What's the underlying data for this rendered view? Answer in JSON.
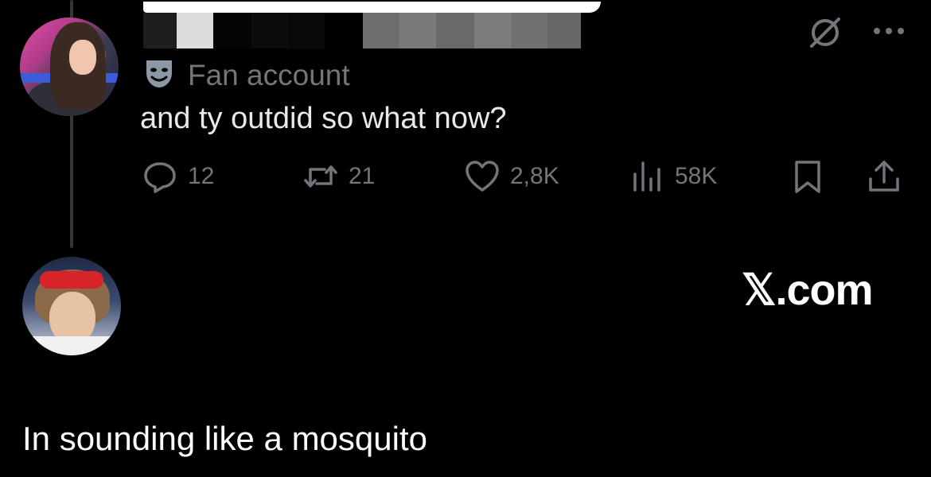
{
  "tweet": {
    "badge_icon": "masks-icon",
    "badge_label": "Fan account",
    "text": "and ty outdid so what now?",
    "actions": {
      "reply_count": "12",
      "repost_count": "21",
      "like_count": "2,8K",
      "views_count": "58K"
    }
  },
  "watermark": "𝕏.com",
  "reply": {
    "text": "In sounding like a mosquito"
  },
  "colors": {
    "background": "#000000",
    "muted": "#71767b",
    "text": "#e7e9ea",
    "thread_line": "#333639"
  }
}
